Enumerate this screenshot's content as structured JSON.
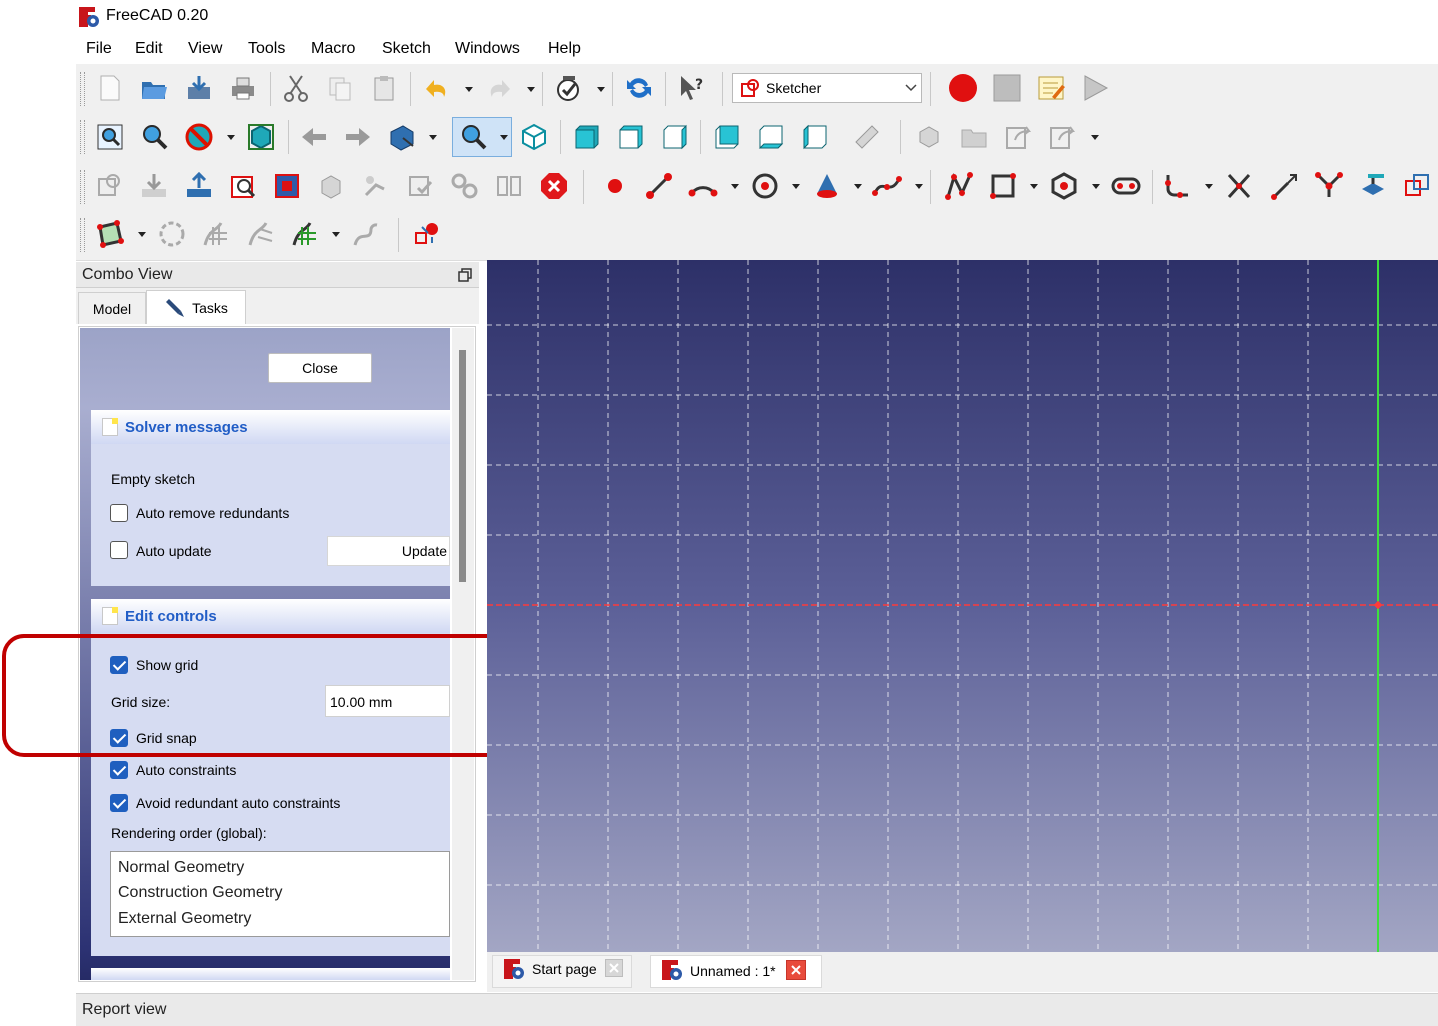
{
  "window": {
    "title": "FreeCAD 0.20"
  },
  "menu": [
    "File",
    "Edit",
    "View",
    "Tools",
    "Macro",
    "Sketch",
    "Windows",
    "Help"
  ],
  "workbench": {
    "selected": "Sketcher"
  },
  "combo_view": {
    "title": "Combo View",
    "tabs": [
      {
        "label": "Model"
      },
      {
        "label": "Tasks"
      }
    ],
    "close_label": "Close",
    "solver": {
      "title": "Solver messages",
      "status": "Empty sketch",
      "auto_remove_label": "Auto remove redundants",
      "auto_remove_checked": false,
      "auto_update_label": "Auto update",
      "auto_update_checked": false,
      "update_label": "Update"
    },
    "edit_controls": {
      "title": "Edit controls",
      "show_grid_label": "Show grid",
      "show_grid_checked": true,
      "grid_size_label": "Grid size:",
      "grid_size_value": "10.00 mm",
      "grid_snap_label": "Grid snap",
      "grid_snap_checked": true,
      "auto_constraints_label": "Auto constraints",
      "auto_constraints_checked": true,
      "avoid_redundant_label": "Avoid redundant auto constraints",
      "avoid_redundant_checked": true,
      "rendering_order_label": "Rendering order (global):",
      "rendering_order": [
        "Normal Geometry",
        "Construction Geometry",
        "External Geometry"
      ]
    }
  },
  "doc_tabs": [
    {
      "label": "Start page"
    },
    {
      "label": "Unnamed : 1*"
    }
  ],
  "report_view": {
    "title": "Report view"
  },
  "colors": {
    "highlight": "#c00000",
    "checkbox": "#1f5fbf",
    "section_title": "#215dc6",
    "x_axis": "#ff3a3a",
    "y_axis": "#3ee03e"
  }
}
